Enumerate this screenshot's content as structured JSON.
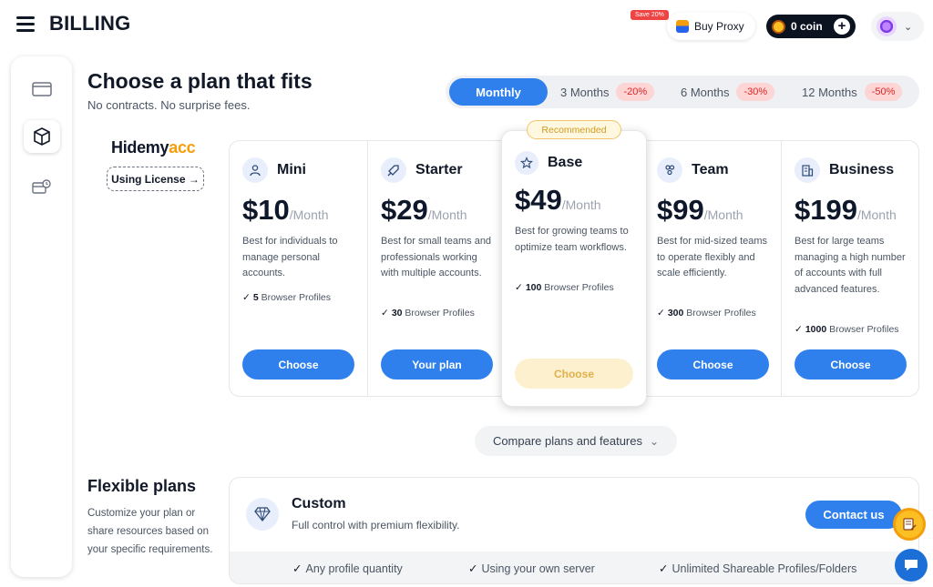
{
  "header": {
    "title": "BILLING",
    "save_badge": "Save 20%",
    "buy_proxy_label": "Buy Proxy",
    "coin_label": "0 coin",
    "plus_symbol": "+"
  },
  "intro": {
    "title": "Choose a plan that fits",
    "subtitle": "No contracts. No surprise fees."
  },
  "periods": [
    {
      "label": "Monthly",
      "discount": "",
      "active": true
    },
    {
      "label": "3 Months",
      "discount": "-20%",
      "active": false
    },
    {
      "label": "6 Months",
      "discount": "-30%",
      "active": false
    },
    {
      "label": "12 Months",
      "discount": "-50%",
      "active": false
    }
  ],
  "brand": {
    "name_part1": "Hidemy",
    "name_part2": "acc",
    "license_label": "Using License →"
  },
  "plans": [
    {
      "name": "Mini",
      "price": "$10",
      "per": "/Month",
      "desc": "Best for individuals to manage personal accounts.",
      "profiles": "5",
      "profiles_label": "Browser Profiles",
      "button": "Choose",
      "icon": "user-icon"
    },
    {
      "name": "Starter",
      "price": "$29",
      "per": "/Month",
      "desc": "Best for small teams and professionals working with multiple accounts.",
      "profiles": "30",
      "profiles_label": "Browser Profiles",
      "button": "Your plan",
      "icon": "rocket-icon"
    },
    {
      "name": "Base",
      "price": "$49",
      "per": "/Month",
      "desc": "Best for growing teams to optimize team workflows.",
      "profiles": "100",
      "profiles_label": "Browser Profiles",
      "button": "Choose",
      "icon": "star-icon",
      "badge": "Recommended"
    },
    {
      "name": "Team",
      "price": "$99",
      "per": "/Month",
      "desc": "Best for mid-sized teams to operate flexibly and scale efficiently.",
      "profiles": "300",
      "profiles_label": "Browser Profiles",
      "button": "Choose",
      "icon": "team-icon"
    },
    {
      "name": "Business",
      "price": "$199",
      "per": "/Month",
      "desc": "Best for large teams managing a high number of accounts with full advanced features.",
      "profiles": "1000",
      "profiles_label": "Browser Profiles",
      "button": "Choose",
      "icon": "building-icon"
    }
  ],
  "compare_label": "Compare plans and features",
  "flexible": {
    "title": "Flexible plans",
    "subtitle": "Customize your plan or share resources based on your specific requirements."
  },
  "custom": {
    "title": "Custom",
    "subtitle": "Full control with premium flexibility.",
    "button": "Contact us",
    "features": [
      "Any profile quantity",
      "Using your own server",
      "Unlimited Shareable Profiles/Folders"
    ]
  },
  "colors": {
    "accent": "#2f80ed",
    "discount_bg": "#fdd5d5",
    "discount_text": "#dc2626",
    "recommended": "#d49a1e"
  }
}
